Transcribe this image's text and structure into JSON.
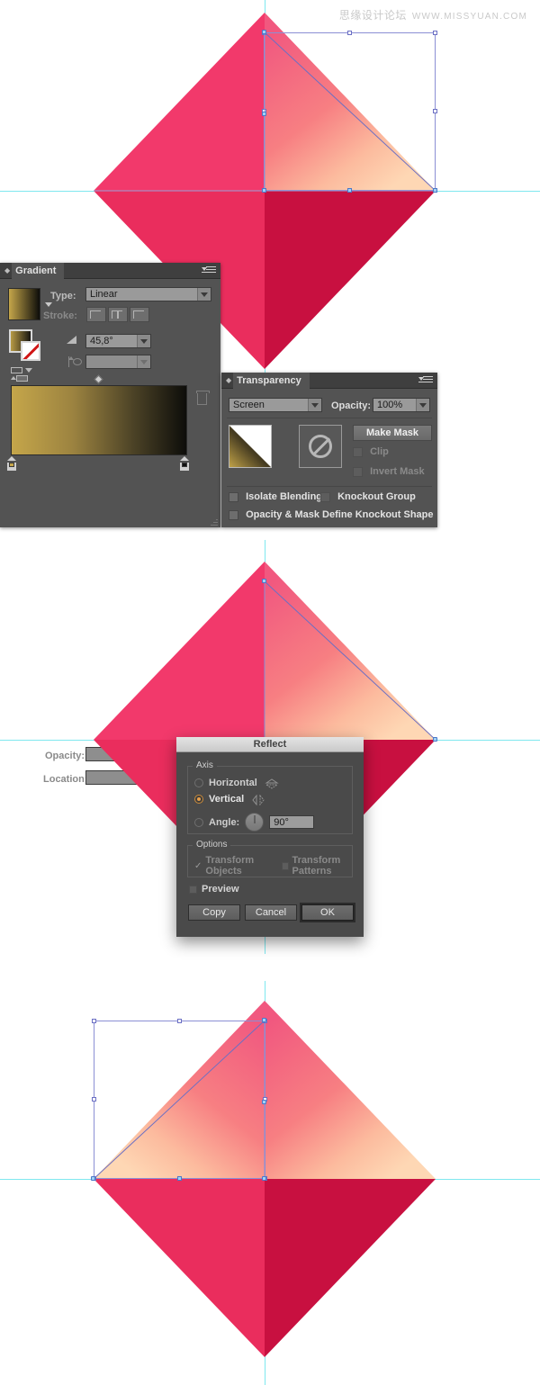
{
  "watermark": {
    "cn": "思缘设计论坛",
    "url": "WWW.MISSYUAN.COM"
  },
  "gradient_panel": {
    "title": "Gradient",
    "type_label": "Type:",
    "type_value": "Linear",
    "stroke_label": "Stroke:",
    "angle_value": "45,8°",
    "aspect_value": "",
    "opacity_label": "Opacity:",
    "opacity_value": "",
    "location_label": "Location:",
    "location_value": "",
    "stop_start_color": "#c5a64a",
    "stop_end_color": "#0d0d0a"
  },
  "transparency_panel": {
    "title": "Transparency",
    "blend_mode": "Screen",
    "opacity_label": "Opacity:",
    "opacity_value": "100%",
    "make_mask_label": "Make Mask",
    "clip_label": "Clip",
    "invert_mask_label": "Invert Mask",
    "isolate_blending_label": "Isolate Blending",
    "knockout_group_label": "Knockout Group",
    "knockout_shape_label": "Opacity & Mask Define Knockout Shape"
  },
  "reflect_dialog": {
    "title": "Reflect",
    "axis_group_label": "Axis",
    "horizontal_label": "Horizontal",
    "vertical_label": "Vertical",
    "angle_label": "Angle:",
    "angle_value": "90°",
    "options_group_label": "Options",
    "transform_objects_label": "Transform Objects",
    "transform_patterns_label": "Transform Patterns",
    "preview_label": "Preview",
    "copy_label": "Copy",
    "cancel_label": "Cancel",
    "ok_label": "OK",
    "selected_axis": "Vertical"
  },
  "artwork": {
    "colors": {
      "top_left": "#f2396b",
      "bottom_left": "#ea2d5d",
      "bottom_right": "#c81040",
      "gradient_light": "#fdd0ae",
      "gradient_mid": "#f8867f",
      "gradient_dark": "#f4537a",
      "guide": "#7fe8ef",
      "selection": "#8b8fd4"
    }
  }
}
